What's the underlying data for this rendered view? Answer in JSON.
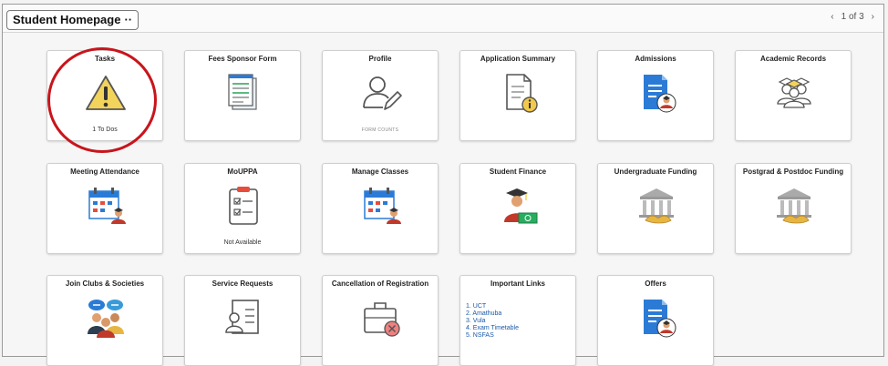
{
  "header": {
    "title": "Student Homepage",
    "title_menu": "··",
    "pager_prev": "‹",
    "pager_text": "1 of 3",
    "pager_next": "›"
  },
  "tiles": [
    {
      "title": "Tasks",
      "icon": "warning-icon",
      "footer": "1  To Dos"
    },
    {
      "title": "Fees Sponsor Form",
      "icon": "form-document-icon",
      "footer": ""
    },
    {
      "title": "Profile",
      "icon": "profile-edit-icon",
      "footer": "FORM COUNTS"
    },
    {
      "title": "Application Summary",
      "icon": "document-info-icon",
      "footer": ""
    },
    {
      "title": "Admissions",
      "icon": "document-person-icon",
      "footer": ""
    },
    {
      "title": "Academic Records",
      "icon": "graduates-icon",
      "footer": ""
    },
    {
      "title": "Meeting Attendance",
      "icon": "calendar-person-icon",
      "footer": ""
    },
    {
      "title": "MoUPPA",
      "icon": "checklist-icon",
      "footer": "Not Available"
    },
    {
      "title": "Manage Classes",
      "icon": "calendar-person-icon",
      "footer": ""
    },
    {
      "title": "Student Finance",
      "icon": "graduate-money-icon",
      "footer": ""
    },
    {
      "title": "Undergraduate Funding",
      "icon": "bank-handshake-icon",
      "footer": ""
    },
    {
      "title": "Postgrad & Postdoc Funding",
      "icon": "bank-handshake-icon",
      "footer": ""
    },
    {
      "title": "Join Clubs & Societies",
      "icon": "people-chat-icon",
      "footer": ""
    },
    {
      "title": "Service Requests",
      "icon": "person-list-icon",
      "footer": ""
    },
    {
      "title": "Cancellation of Registration",
      "icon": "briefcase-cancel-icon",
      "footer": ""
    },
    {
      "title": "Important Links",
      "icon": "",
      "footer": ""
    },
    {
      "title": "Offers",
      "icon": "document-person-icon",
      "footer": ""
    }
  ],
  "important_links": [
    "1. UCT",
    "2. Amathuba",
    "3. Vula",
    "4. Exam Timetable",
    "5. NSFAS"
  ],
  "colors": {
    "highlight_circle": "#c8151b",
    "link": "#1a5aa8",
    "doc_blue": "#2b7bd6",
    "warning_yellow": "#f2d35b",
    "gold": "#e7b642"
  }
}
